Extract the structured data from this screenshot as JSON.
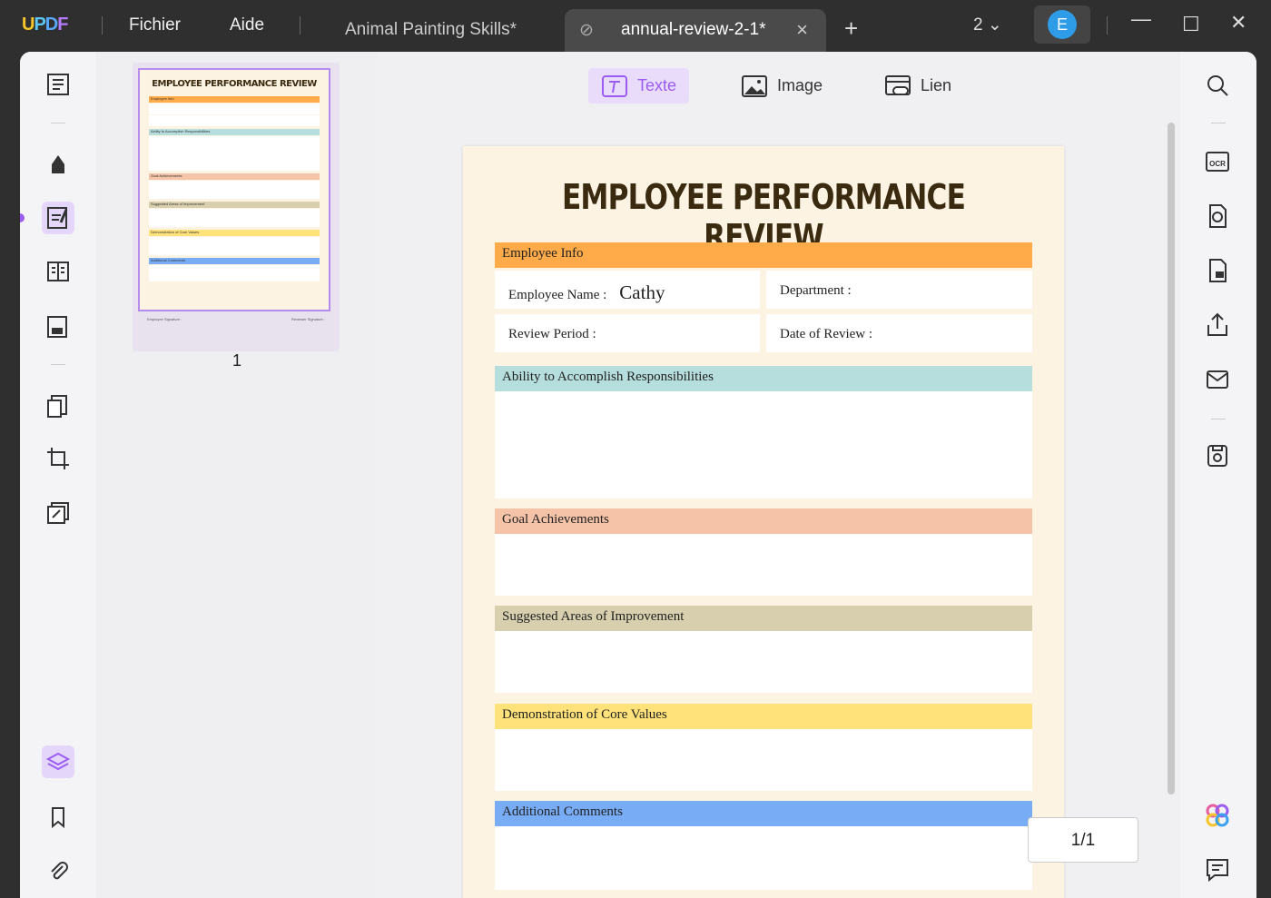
{
  "titlebar": {
    "logo": "UPDF",
    "menu": [
      "Fichier",
      "Aide"
    ],
    "tabs": [
      {
        "label": "Animal Painting Skills*"
      },
      {
        "label": "annual-review-2-1*",
        "active": true
      }
    ],
    "window_count": "2",
    "avatar": "E"
  },
  "toolbar": {
    "text": "Texte",
    "image": "Image",
    "link": "Lien",
    "active": "Texte"
  },
  "thumbnail": {
    "page_number": "1",
    "title": "EMPLOYEE PERFORMANCE REVIEW",
    "employee_signature": "Employee Signature :",
    "reviewer_signature": "Reviewer Signature :"
  },
  "document": {
    "title": "EMPLOYEE PERFORMANCE REVIEW",
    "employee_info": "Employee Info",
    "employee_name_label": "Employee Name :",
    "employee_name_value": "Cathy",
    "department_label": "Department :",
    "review_period_label": "Review Period :",
    "date_of_review_label": "Date of Review :",
    "sections": [
      {
        "label": "Ability to Accomplish Responsibilities",
        "color": "#b5dedd"
      },
      {
        "label": "Goal Achievements",
        "color": "#f5c3a8"
      },
      {
        "label": "Suggested Areas of Improvement",
        "color": "#d8cfae"
      },
      {
        "label": "Demonstration of Core Values",
        "color": "#ffe27a"
      },
      {
        "label": "Additional Comments",
        "color": "#78acf5"
      }
    ],
    "info_color": "#ffab4a"
  },
  "pager": "1/1",
  "colors": {
    "accent": "#9b5cf0"
  }
}
